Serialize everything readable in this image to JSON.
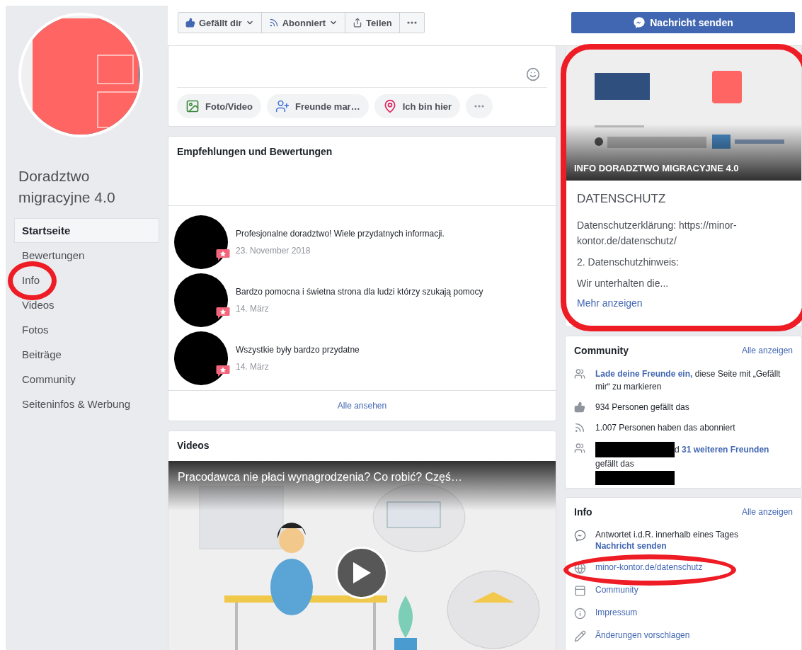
{
  "sidebar": {
    "page_name": "Doradztwo migracyjne 4.0",
    "nav": [
      {
        "label": "Startseite",
        "selected": true
      },
      {
        "label": "Bewertungen",
        "selected": false
      },
      {
        "label": "Info",
        "selected": false
      },
      {
        "label": "Videos",
        "selected": false
      },
      {
        "label": "Fotos",
        "selected": false
      },
      {
        "label": "Beiträge",
        "selected": false
      },
      {
        "label": "Community",
        "selected": false
      },
      {
        "label": "Seiteninfos & Werbung",
        "selected": false
      }
    ]
  },
  "action_bar": {
    "buttons": [
      {
        "label": "Gefällt dir",
        "caret": true
      },
      {
        "label": "Abonniert",
        "caret": true
      },
      {
        "label": "Teilen",
        "caret": false
      },
      {
        "caret": false
      }
    ],
    "message_button": "Nachricht senden"
  },
  "composer": {
    "actions": [
      {
        "kind": "action",
        "label": "Foto/Video"
      },
      {
        "kind": "action",
        "label": "Freunde mar…"
      },
      {
        "kind": "action",
        "label": "Ich bin hier"
      },
      {
        "kind": "more"
      }
    ]
  },
  "reviews": {
    "title": "Empfehlungen und Bewertungen",
    "items": [
      {
        "text": "Profesjonalne doradztwo! Wiele przydatnych informacji.",
        "date": "23. November 2018"
      },
      {
        "text": "Bardzo pomocna i świetna strona dla ludzi którzy szukają pomocy",
        "date": "14. März"
      },
      {
        "text": "Wszystkie były bardzo przydatne",
        "date": "14. März"
      }
    ],
    "see_all": "Alle ansehen"
  },
  "videos": {
    "title": "Videos",
    "video_title": "Pracodawca nie płaci wynagrodzenia? Co robić? Częś…"
  },
  "about_card": {
    "caption": "INFO DORADZTWO MIGRACYJNE 4.0",
    "heading": "DATENSCHUTZ",
    "paragraphs": [
      "Datenschutzerklärung: https://minor-kontor.de/datenschutz/",
      "2. Datenschutzhinweis:",
      "Wir unterhalten die..."
    ],
    "more": "Mehr anzeigen"
  },
  "community": {
    "title": "Community",
    "see_all": "Alle anzeigen",
    "rows": [
      {
        "link": "Lade deine Freunde ein,",
        "text": "diese Seite mit „Gefällt mir“ zu markieren",
        "redacted": false
      },
      {
        "text": "934 Personen gefällt das",
        "redacted": false
      },
      {
        "text": "1.007 Personen haben das abonniert",
        "redacted": false
      },
      {
        "lead": "d",
        "link": "31 weiteren Freunden",
        "text": "gefällt das",
        "redacted": true
      }
    ]
  },
  "info": {
    "title": "Info",
    "see_all": "Alle anzeigen",
    "rows": [
      {
        "text": "Antwortet i.d.R. innerhalb eines Tages",
        "link": "Nachricht senden"
      },
      {
        "link": "minor-kontor.de/datenschutz"
      },
      {
        "link": "Community"
      },
      {
        "link": "Impressum"
      },
      {
        "link": "Änderungen vorschlagen"
      }
    ]
  }
}
